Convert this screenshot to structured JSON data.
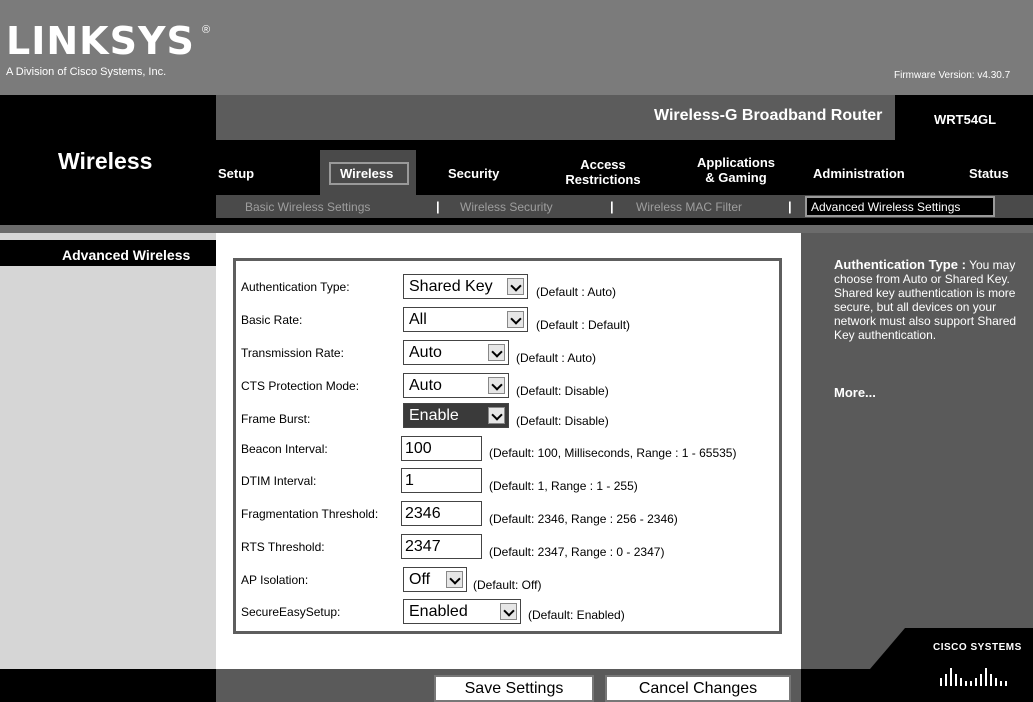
{
  "brand": {
    "logo": "LINKSYS",
    "registered": "®",
    "tagline": "A Division of Cisco Systems, Inc.",
    "firmware": "Firmware Version: v4.30.7"
  },
  "product": {
    "name": "Wireless-G Broadband Router",
    "model": "WRT54GL"
  },
  "section_title": "Wireless",
  "tabs": [
    {
      "line1": "Setup",
      "line2": ""
    },
    {
      "line1": "Wireless",
      "line2": ""
    },
    {
      "line1": "Security",
      "line2": ""
    },
    {
      "line1": "Access",
      "line2": "Restrictions"
    },
    {
      "line1": "Applications",
      "line2": "& Gaming"
    },
    {
      "line1": "Administration",
      "line2": ""
    },
    {
      "line1": "Status",
      "line2": ""
    }
  ],
  "subnav": {
    "items": [
      "Basic Wireless Settings",
      "Wireless Security",
      "Wireless MAC Filter",
      "Advanced Wireless Settings"
    ],
    "separator": "|",
    "active_index": 3
  },
  "left_heading": "Advanced Wireless",
  "form": {
    "authentication_type": {
      "label": "Authentication Type:",
      "value": "Shared Key",
      "hint": "(Default : Auto)"
    },
    "basic_rate": {
      "label": "Basic Rate:",
      "value": "All",
      "hint": "(Default : Default)"
    },
    "transmission_rate": {
      "label": "Transmission Rate:",
      "value": "Auto",
      "hint": "(Default : Auto)"
    },
    "cts_protection": {
      "label": "CTS Protection Mode:",
      "value": "Auto",
      "hint": "(Default: Disable)"
    },
    "frame_burst": {
      "label": "Frame Burst:",
      "value": "Enable",
      "hint": "(Default: Disable)"
    },
    "beacon_interval": {
      "label": "Beacon Interval:",
      "value": "100",
      "hint": "(Default: 100, Milliseconds, Range : 1 - 65535)"
    },
    "dtim_interval": {
      "label": "DTIM Interval:",
      "value": "1",
      "hint": "(Default: 1, Range : 1 - 255)"
    },
    "fragmentation_threshold": {
      "label": "Fragmentation Threshold:",
      "value": "2346",
      "hint": "(Default: 2346, Range : 256 - 2346)"
    },
    "rts_threshold": {
      "label": "RTS Threshold:",
      "value": "2347",
      "hint": "(Default: 2347, Range : 0 - 2347)"
    },
    "ap_isolation": {
      "label": "AP Isolation:",
      "value": "Off",
      "hint": "(Default: Off)"
    },
    "secure_easy_setup": {
      "label": "SecureEasySetup:",
      "value": "Enabled",
      "hint": "(Default: Enabled)"
    }
  },
  "help": {
    "title": "Authentication Type :",
    "body": "You may choose from Auto or Shared Key. Shared key authentication is more secure, but all devices on your network must also support Shared Key authentication.",
    "more": "More..."
  },
  "buttons": {
    "save": "Save Settings",
    "cancel": "Cancel Changes"
  },
  "footer_logo": "Cisco Systems",
  "colors": {
    "header": "#7b7b7b",
    "band": "#000000",
    "help_panel": "#5a5a5a",
    "left_column": "#d6d6d6"
  },
  "icons": [
    "dropdown-arrow-icon",
    "cisco-bridge-icon"
  ]
}
